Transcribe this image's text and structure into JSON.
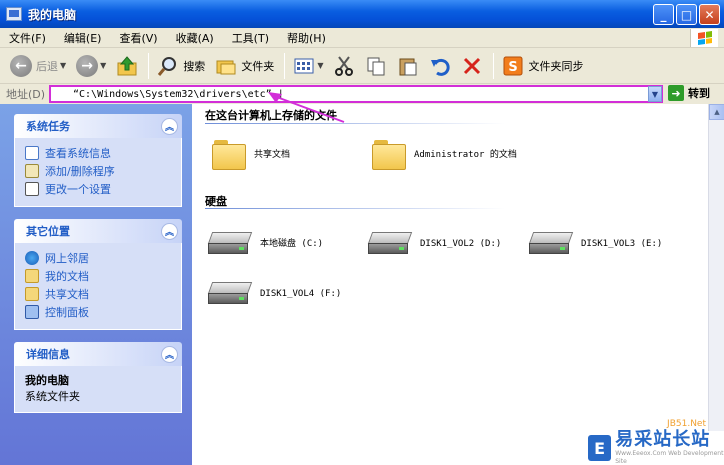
{
  "window": {
    "title": "我的电脑",
    "controls": {
      "minimize": "_",
      "maximize": "□",
      "close": "✕"
    }
  },
  "menu": [
    "文件(F)",
    "编辑(E)",
    "查看(V)",
    "收藏(A)",
    "工具(T)",
    "帮助(H)"
  ],
  "toolbar": {
    "back_label": "后退",
    "search_label": "搜索",
    "folders_label": "文件夹",
    "sync_label": "文件夹同步"
  },
  "address": {
    "label": "地址(D)",
    "value": "“C:\\Windows\\System32\\drivers\\etc” |",
    "go_label": "转到"
  },
  "sidebar": {
    "system_tasks": {
      "title": "系统任务",
      "items": [
        "查看系统信息",
        "添加/删除程序",
        "更改一个设置"
      ]
    },
    "other_places": {
      "title": "其它位置",
      "items": [
        "网上邻居",
        "我的文档",
        "共享文档",
        "控制面板"
      ]
    },
    "details": {
      "title": "详细信息",
      "name": "我的电脑",
      "desc": "系统文件夹"
    }
  },
  "content": {
    "stored_group": "在这台计算机上存储的文件",
    "folders": [
      "共享文档",
      "Administrator 的文档"
    ],
    "drives_group": "硬盘",
    "drives": [
      "本地磁盘 (C:)",
      "DISK1_VOL2 (D:)",
      "DISK1_VOL3 (E:)",
      "DISK1_VOL4 (F:)"
    ]
  },
  "watermark": {
    "logo": "E",
    "text": "易采站长站",
    "sub": "Www.Eeeox.Com Web Development Site",
    "peek": "JB51.Net"
  },
  "accent_colors": {
    "titlebar": "#0551d8",
    "highlight_box": "#d22ed8",
    "sidebar_link": "#215dc6"
  }
}
